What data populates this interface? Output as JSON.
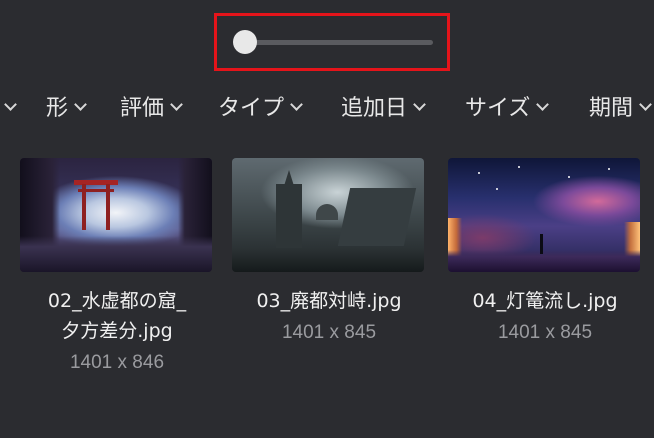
{
  "zoom_slider": {
    "level": 0.0
  },
  "filters": [
    {
      "label": ""
    },
    {
      "label": "形"
    },
    {
      "label": "評価"
    },
    {
      "label": "タイプ"
    },
    {
      "label": "追加日"
    },
    {
      "label": "サイズ"
    },
    {
      "label": "期間"
    }
  ],
  "images": [
    {
      "filename": "02_水虚都の窟_夕方差分.jpg",
      "filename_line1": "02_水虚都の窟_",
      "filename_line2": "夕方差分.jpg",
      "dimensions": "1401 x 846"
    },
    {
      "filename": "03_廃都対峙.jpg",
      "dimensions": "1401 x 845"
    },
    {
      "filename": "04_灯篭流し.jpg",
      "dimensions": "1401 x 845"
    }
  ],
  "colors": {
    "background": "#2b2c30",
    "highlight_box": "#e5141a",
    "text_primary": "#f0f0f0",
    "text_secondary": "#9a9b9f"
  }
}
